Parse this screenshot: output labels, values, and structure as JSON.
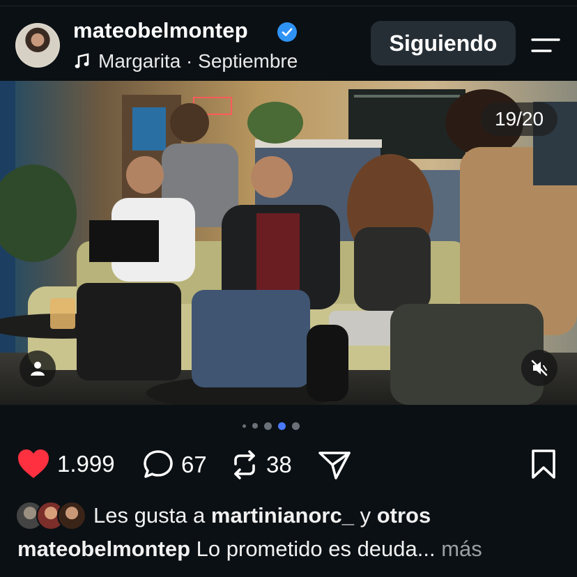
{
  "post": {
    "username": "mateobelmontep",
    "audio": "Margarita · Septiembre",
    "follow_label": "Siguiendo",
    "slide_counter": "19/20",
    "carousel": {
      "total_dots": 5,
      "active_dot_index": 3
    },
    "likes_count": "1.999",
    "comments_count": "67",
    "reposts_count": "38",
    "liked_by_prefix": "Les gusta a",
    "liked_by_user": "martinianorc_",
    "liked_by_joiner": "y",
    "liked_by_others": "otros",
    "caption_user": "mateobelmontep",
    "caption_text": "Lo prometido es deuda...",
    "caption_more": "más"
  },
  "icons": {
    "verified": "verified-badge-icon",
    "music": "music-note-icon",
    "menu": "menu-icon",
    "like": "heart-icon",
    "comment": "comment-icon",
    "repost": "repost-icon",
    "share": "send-icon",
    "save": "bookmark-icon",
    "tags": "user-tag-icon",
    "mute": "muted-speaker-icon"
  },
  "colors": {
    "background": "#0b1014",
    "like": "#ff3040",
    "verified": "#2f93f5",
    "active_dot": "#4a7bff",
    "button_bg": "#262e35"
  }
}
